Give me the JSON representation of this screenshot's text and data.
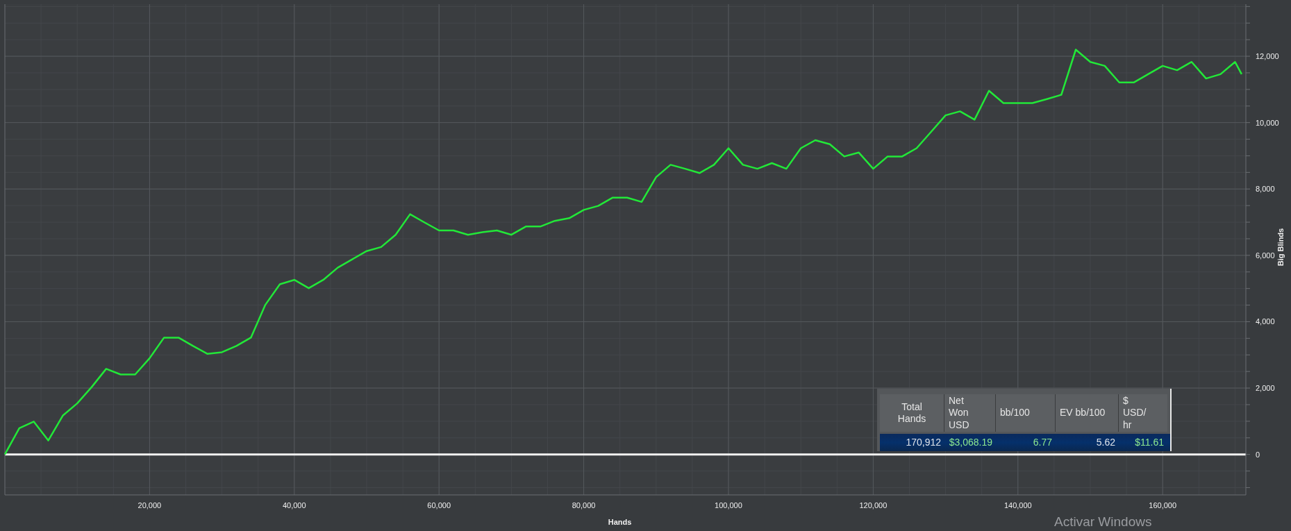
{
  "chart": {
    "chart_data": {
      "type": "line",
      "xlabel": "Hands",
      "ylabel": "Big Blinds",
      "x": [
        0,
        2000,
        4000,
        6000,
        8000,
        10000,
        12000,
        14000,
        16000,
        18000,
        20000,
        22000,
        24000,
        26000,
        28000,
        30000,
        32000,
        34000,
        36000,
        38000,
        40000,
        42000,
        44000,
        46000,
        48000,
        50000,
        52000,
        54000,
        56000,
        58000,
        60000,
        62000,
        64000,
        66000,
        68000,
        70000,
        72000,
        74000,
        76000,
        78000,
        80000,
        82000,
        84000,
        86000,
        88000,
        90000,
        92000,
        94000,
        96000,
        98000,
        100000,
        102000,
        104000,
        106000,
        108000,
        110000,
        112000,
        114000,
        116000,
        118000,
        120000,
        122000,
        124000,
        126000,
        128000,
        130000,
        132000,
        134000,
        136000,
        138000,
        140000,
        142000,
        144000,
        146000,
        148000,
        150000,
        152000,
        154000,
        156000,
        158000,
        160000,
        162000,
        164000,
        166000,
        168000,
        170000,
        170912
      ],
      "series": [
        {
          "color": "#22e838",
          "values": [
            0,
            790,
            990,
            420,
            1170,
            1540,
            2030,
            2580,
            2410,
            2410,
            2900,
            3520,
            3520,
            3270,
            3030,
            3080,
            3270,
            3520,
            4510,
            5130,
            5260,
            5010,
            5260,
            5630,
            5880,
            6130,
            6250,
            6620,
            7240,
            6990,
            6750,
            6750,
            6620,
            6700,
            6750,
            6620,
            6870,
            6870,
            7040,
            7120,
            7370,
            7490,
            7740,
            7740,
            7610,
            8360,
            8730,
            8610,
            8480,
            8730,
            9230,
            8730,
            8610,
            8780,
            8610,
            9230,
            9470,
            9350,
            8980,
            9100,
            8610,
            8980,
            8980,
            9230,
            9720,
            10220,
            10340,
            10090,
            10960,
            10590,
            10590,
            10590,
            10710,
            10840,
            12200,
            11830,
            11710,
            11210,
            11210,
            11460,
            11710,
            11580,
            11830,
            11330,
            11460,
            11830,
            11460
          ]
        }
      ],
      "grid": true,
      "xlim": [
        0,
        171500
      ],
      "ylim": [
        -1220,
        13570
      ],
      "xticks": [
        {
          "value": 20000,
          "label": "20,000"
        },
        {
          "value": 40000,
          "label": "40,000"
        },
        {
          "value": 60000,
          "label": "60,000"
        },
        {
          "value": 80000,
          "label": "80,000"
        },
        {
          "value": 100000,
          "label": "100,000"
        },
        {
          "value": 120000,
          "label": "120,000"
        },
        {
          "value": 140000,
          "label": "140,000"
        },
        {
          "value": 160000,
          "label": "160,000"
        }
      ],
      "yticks": [
        {
          "value": 0,
          "label": "0"
        },
        {
          "value": 2000,
          "label": "2,000"
        },
        {
          "value": 4000,
          "label": "4,000"
        },
        {
          "value": 6000,
          "label": "6,000"
        },
        {
          "value": 8000,
          "label": "8,000"
        },
        {
          "value": 10000,
          "label": "10,000"
        },
        {
          "value": 12000,
          "label": "12,000"
        }
      ]
    }
  },
  "stats_table": {
    "columns": [
      {
        "lines": [
          "Total",
          "Hands"
        ]
      },
      {
        "lines": [
          "Net",
          "Won",
          "USD"
        ]
      },
      {
        "lines": [
          "bb/100"
        ]
      },
      {
        "lines": [
          "EV bb/100"
        ]
      },
      {
        "lines": [
          "$",
          "USD/",
          "hr"
        ]
      }
    ],
    "rows": [
      {
        "selected": true,
        "cells": [
          {
            "text": "170,912",
            "highlighted": false
          },
          {
            "text": "$3,068.19",
            "highlighted": true
          },
          {
            "text": "6.77",
            "highlighted": true
          },
          {
            "text": "5.62",
            "highlighted": false
          },
          {
            "text": "$11.61",
            "highlighted": true
          }
        ]
      }
    ]
  },
  "os_notice": "Activar Windows"
}
